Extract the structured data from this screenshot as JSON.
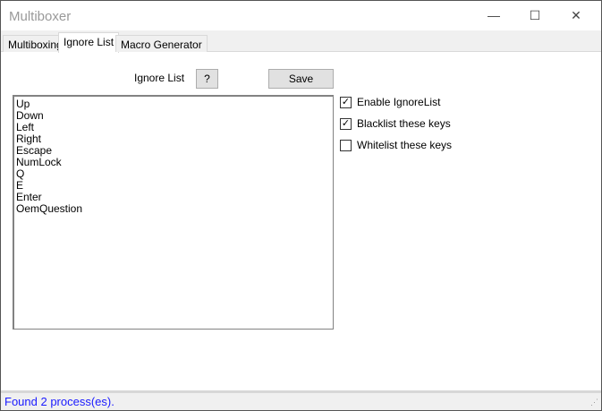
{
  "window": {
    "title": "Multiboxer",
    "minimize": "—",
    "maximize": "☐",
    "close": "✕"
  },
  "tabs": [
    {
      "label": "Multiboxing"
    },
    {
      "label": "Ignore List"
    },
    {
      "label": "Macro Generator"
    }
  ],
  "ignore": {
    "label": "Ignore List",
    "help": "?",
    "save": "Save",
    "items": [
      "Up",
      "Down",
      "Left",
      "Right",
      "Escape",
      "NumLock",
      "Q",
      "E",
      "Enter",
      "OemQuestion"
    ],
    "options": [
      {
        "label": "Enable IgnoreList",
        "checked": true
      },
      {
        "label": "Blacklist these keys",
        "checked": true
      },
      {
        "label": "Whitelist these keys",
        "checked": false
      }
    ]
  },
  "status": {
    "text": "Found 2 process(es)."
  }
}
